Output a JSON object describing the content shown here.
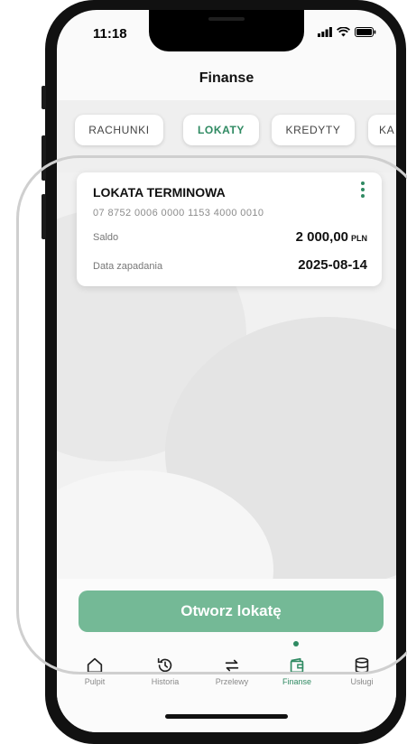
{
  "status": {
    "time": "11:18"
  },
  "header": {
    "title": "Finanse"
  },
  "tabs": [
    {
      "label": "RACHUNKI",
      "active": false
    },
    {
      "label": "LOKATY",
      "active": true
    },
    {
      "label": "KREDYTY",
      "active": false
    },
    {
      "label": "KA",
      "active": false
    }
  ],
  "deposit": {
    "title": "LOKATA TERMINOWA",
    "account_number": "07 8752 0006 0000 1153 4000 0010",
    "balance_label": "Saldo",
    "balance_amount": "2 000,00",
    "balance_currency": "PLN",
    "due_label": "Data zapadania",
    "due_date": "2025-08-14"
  },
  "action": {
    "open_label": "Otworz lokatę"
  },
  "nav": [
    {
      "label": "Pulpit",
      "icon": "home-icon"
    },
    {
      "label": "Historia",
      "icon": "history-icon"
    },
    {
      "label": "Przelewy",
      "icon": "transfer-icon"
    },
    {
      "label": "Finanse",
      "icon": "wallet-icon",
      "active": true
    },
    {
      "label": "Usługi",
      "icon": "database-icon"
    }
  ],
  "colors": {
    "accent": "#2f8a62",
    "button": "#74b996"
  }
}
